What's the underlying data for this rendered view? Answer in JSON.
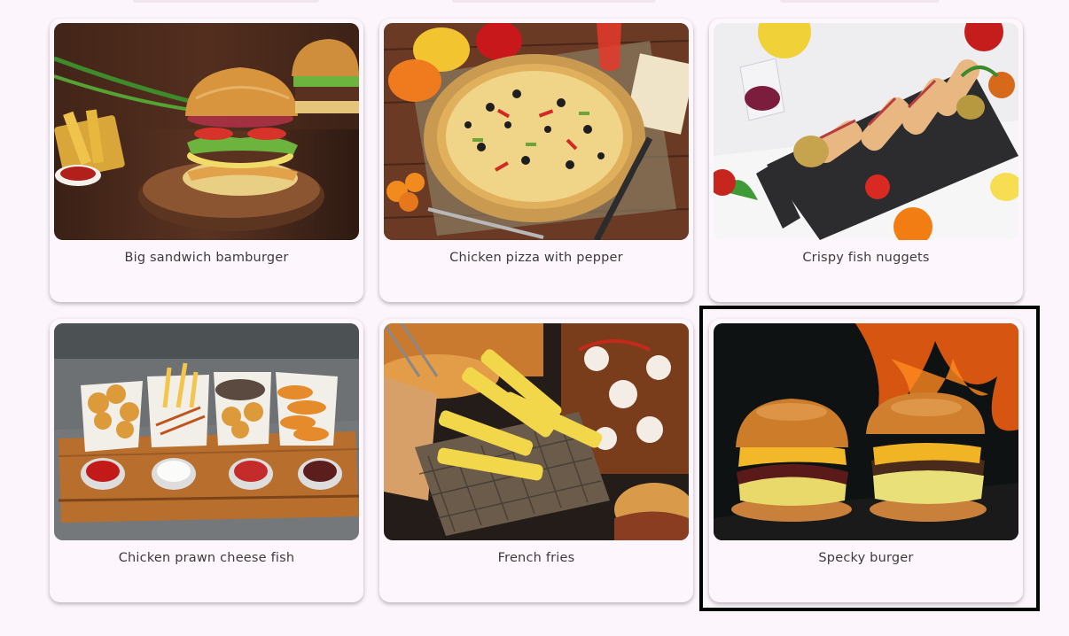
{
  "menu": {
    "items": [
      {
        "label": "Big sandwich bamburger",
        "image_icon": "burger-photo"
      },
      {
        "label": "Chicken pizza with pepper",
        "image_icon": "pizza-photo"
      },
      {
        "label": "Crispy fish nuggets",
        "image_icon": "fish-nuggets-photo"
      },
      {
        "label": "Chicken prawn cheese fish",
        "image_icon": "fried-platter-photo"
      },
      {
        "label": "French fries",
        "image_icon": "fries-photo"
      },
      {
        "label": "Specky burger",
        "image_icon": "double-burger-photo"
      }
    ],
    "selected_index": 5
  },
  "colors": {
    "background": "#fcf5fc",
    "card": "#fdf7fd",
    "label_text": "#3b3b3b",
    "selection_border": "#050505"
  }
}
